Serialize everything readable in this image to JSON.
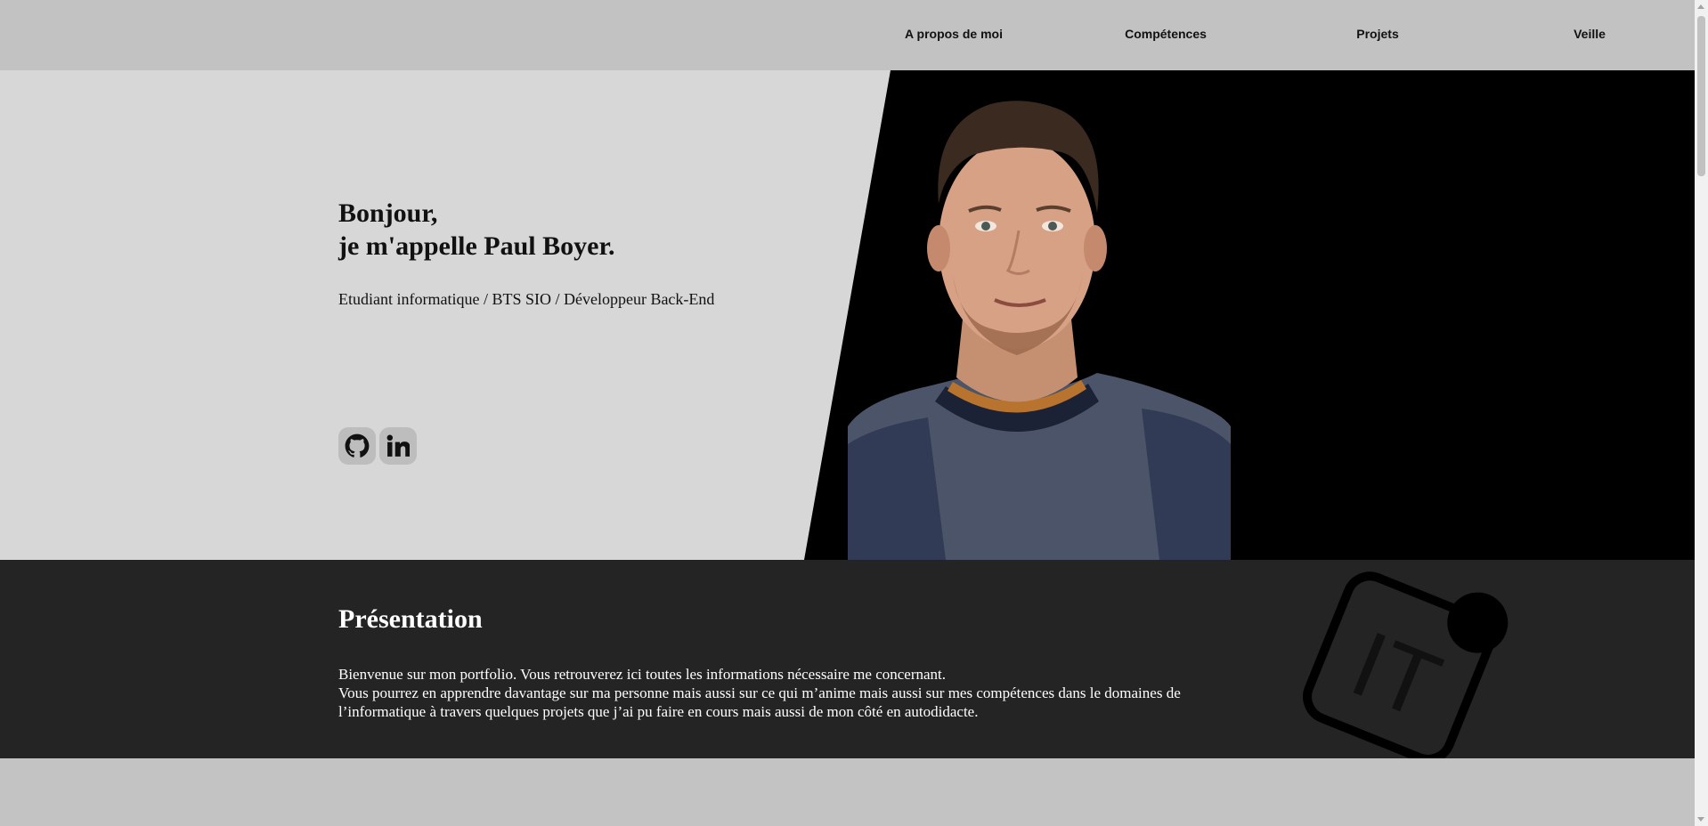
{
  "nav": {
    "items": [
      {
        "label": "A propos de moi"
      },
      {
        "label": "Compétences"
      },
      {
        "label": "Projets"
      },
      {
        "label": "Veille"
      }
    ]
  },
  "hero": {
    "greeting_line1": "Bonjour,",
    "greeting_line2": "je m'appelle Paul Boyer.",
    "subtitle": "Etudiant informatique / BTS SIO / Développeur Back-End",
    "social": [
      {
        "icon": "github-icon"
      },
      {
        "icon": "linkedin-icon"
      }
    ],
    "colors": {
      "panel": "#d7d7d7",
      "dark_panel": "#000000"
    }
  },
  "presentation": {
    "title": "Présentation",
    "line1": "Bienvenue sur mon portfolio. Vous retrouverez ici toutes les informations nécessaire me concernant.",
    "line2": "Vous pourrez en apprendre davantage sur ma personne mais aussi sur ce qui m’anime mais aussi sur mes compétences dans le domaines de l’informatique à travers quelques projets que j’ai pu faire en cours mais aussi de mon côté en autodidacte.",
    "logo_text": "IT",
    "colors": {
      "background": "#242424",
      "text": "#ffffff"
    }
  }
}
